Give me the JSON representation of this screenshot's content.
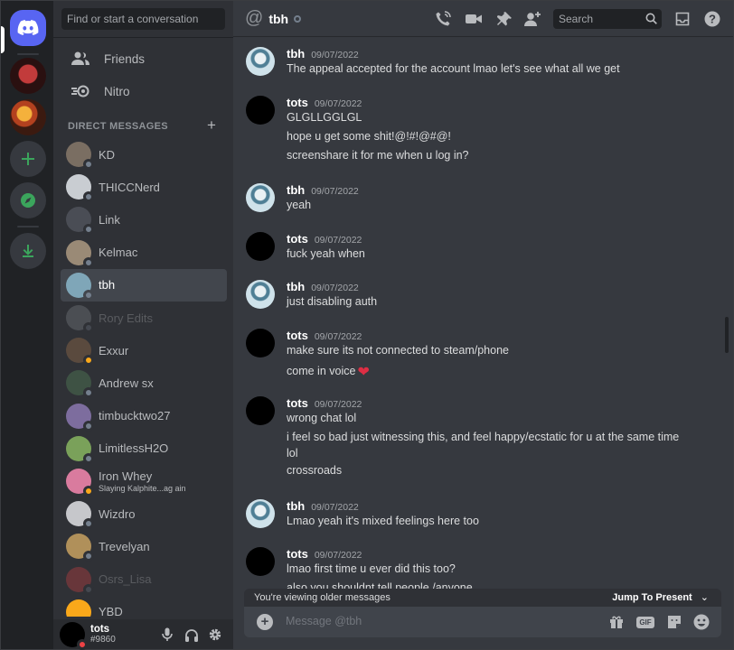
{
  "search": {
    "placeholder": "Find or start a conversation"
  },
  "nav": [
    {
      "label": "Friends",
      "icon": "friends-icon"
    },
    {
      "label": "Nitro",
      "icon": "nitro-icon"
    }
  ],
  "dm_section": {
    "label": "DIRECT MESSAGES"
  },
  "dms": [
    {
      "name": "KD",
      "status": "off",
      "avatar_color": "#7a6e62"
    },
    {
      "name": "THICCNerd",
      "status": "off",
      "avatar_color": "#c9cdd2"
    },
    {
      "name": "Link",
      "status": "off",
      "avatar_color": "#4a4d55"
    },
    {
      "name": "Kelmac",
      "status": "off",
      "avatar_color": "#9a8a76"
    },
    {
      "name": "tbh",
      "status": "off",
      "avatar_color": "#7fa6b8",
      "active": true
    },
    {
      "name": "Rory Edits",
      "status": "off",
      "avatar_color": "#8e9297",
      "dim": true
    },
    {
      "name": "Exxur",
      "status": "idle",
      "avatar_color": "#5a4a3e"
    },
    {
      "name": "Andrew sx",
      "status": "off",
      "avatar_color": "#3e5244"
    },
    {
      "name": "timbucktwo27",
      "status": "off",
      "avatar_color": "#7d6d9e"
    },
    {
      "name": "LimitlessH2O",
      "status": "off",
      "avatar_color": "#7aa15a"
    },
    {
      "name": "Iron Whey",
      "sub": "Slaying Kalphite...ag ain",
      "status": "idle",
      "avatar_color": "#d97b9e"
    },
    {
      "name": "Wizdro",
      "status": "off",
      "avatar_color": "#c6c7cb"
    },
    {
      "name": "Trevelyan",
      "status": "off",
      "avatar_color": "#b0905a"
    },
    {
      "name": "Osrs_Lisa",
      "status": "off",
      "avatar_color": "#ed4245",
      "dim": true
    },
    {
      "name": "YBD",
      "status": "off",
      "avatar_color": "#faa81a"
    }
  ],
  "user": {
    "name": "tots",
    "tag": "#9860"
  },
  "channel": {
    "name": "tbh"
  },
  "header": {
    "search_placeholder": "Search"
  },
  "messages": [
    {
      "user": "tbh",
      "time": "09/07/2022",
      "lines": [
        "The appeal accepted for the account lmao let's see what all we get"
      ]
    },
    {
      "user": "tots",
      "time": "09/07/2022",
      "lines": [
        "GLGLLGGLGL",
        "hope u get some shit!@!#!@#@!",
        "screenshare it for me when u log in?"
      ]
    },
    {
      "user": "tbh",
      "time": "09/07/2022",
      "lines": [
        "yeah"
      ]
    },
    {
      "user": "tots",
      "time": "09/07/2022",
      "lines": [
        "fuck yeah when"
      ]
    },
    {
      "user": "tbh",
      "time": "09/07/2022",
      "lines": [
        "just disabling auth"
      ]
    },
    {
      "user": "tots",
      "time": "09/07/2022",
      "lines": [
        "make sure its not connected to steam/phone",
        "come in voice"
      ]
    },
    {
      "user": "tots",
      "time": "09/07/2022",
      "lines": [
        "wrong chat lol",
        "i feel so bad just witnessing this, and feel happy/ecstatic for u at the same time",
        "lol",
        "crossroads"
      ]
    },
    {
      "user": "tbh",
      "time": "09/07/2022",
      "lines": [
        "Lmao yeah it's mixed feelings here too"
      ]
    },
    {
      "user": "tots",
      "time": "09/07/2022",
      "lines": [
        "lmao first time u ever did this too?",
        "also you shouldnt tell people /anyone"
      ]
    }
  ],
  "older_bar": {
    "label": "You're viewing older messages",
    "jump_label": "Jump To Present"
  },
  "composer": {
    "placeholder": "Message @tbh"
  }
}
